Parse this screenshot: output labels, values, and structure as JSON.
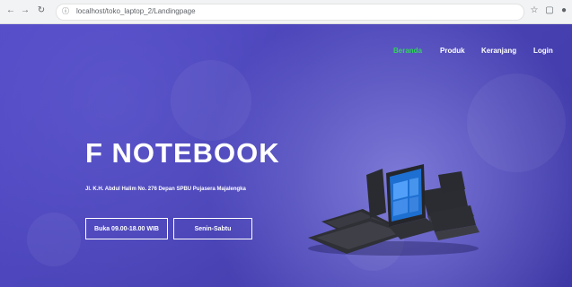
{
  "browser": {
    "url": "localhost/toko_laptop_2/Landingpage"
  },
  "nav": {
    "items": [
      "Beranda",
      "Produk",
      "Keranjang",
      "Login"
    ],
    "active_index": 0
  },
  "hero": {
    "title": "F NOTEBOOK",
    "address": "Jl. K.H. Abdul Halim No. 276 Depan SPBU Pujasera Majalengka",
    "buttons": [
      "Buka 09.00-18.00 WIB",
      "Senin-Sabtu"
    ]
  },
  "colors": {
    "background": "#4a44b7",
    "active_nav": "#32d35c",
    "text": "#ffffff"
  }
}
